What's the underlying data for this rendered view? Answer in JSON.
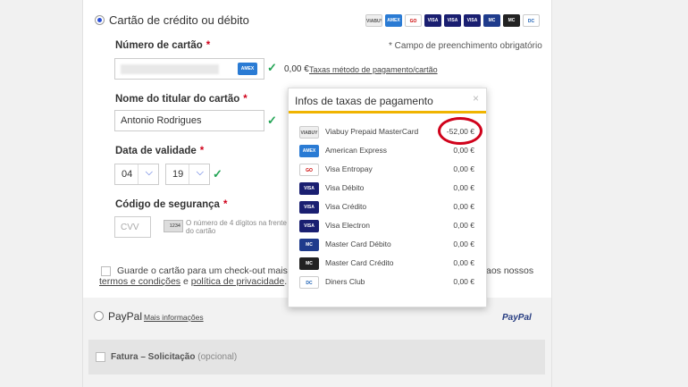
{
  "card_section": {
    "title": "Cartão de crédito ou débito",
    "card_number_label": "Número de cartão",
    "required_note": "* Campo de preenchimento obrigatório",
    "fee_amount": "0,00 €",
    "fee_link": "Taxas método de pagamento/cartão",
    "holder_label": "Nome do titular do cartão",
    "holder_value": "Antonio Rodrigues",
    "expiry_label": "Data de validade",
    "expiry_month": "04",
    "expiry_year": "19",
    "cvv_label": "Código de segurança",
    "cvv_placeholder": "CVV",
    "cvv_card_number": "1234",
    "cvv_help": "O número de 4 dígitos na frente do cartão",
    "save_text": "Guarde o cartão para um check-out mais rápido",
    "save_text_tail": "aos nossos",
    "terms_link": "termos e condições",
    "and_text": "e",
    "privacy_link": "política de privacidade",
    "period": ".",
    "required_mark": "*",
    "check_mark": "✓"
  },
  "header_logos": [
    {
      "name": "viabuy-logo",
      "text": "VIABUY"
    },
    {
      "name": "amex-logo",
      "text": "AMEX"
    },
    {
      "name": "entropay-logo",
      "text": "GO"
    },
    {
      "name": "visa-debit-logo",
      "text": "VISA"
    },
    {
      "name": "visa-logo",
      "text": "VISA"
    },
    {
      "name": "visa-electron-logo",
      "text": "VISA"
    },
    {
      "name": "maestro-logo",
      "text": "MC"
    },
    {
      "name": "mastercard-logo",
      "text": "MC"
    },
    {
      "name": "diners-logo",
      "text": "DC"
    }
  ],
  "popup": {
    "title": "Infos de taxas de pagamento",
    "close": "×",
    "rows": [
      {
        "name": "Viabuy Prepaid MasterCard",
        "amount": "-52,00 €",
        "logo": "VIABUY"
      },
      {
        "name": "American Express",
        "amount": "0,00 €",
        "logo": "AMEX"
      },
      {
        "name": "Visa Entropay",
        "amount": "0,00 €",
        "logo": "GO"
      },
      {
        "name": "Visa Débito",
        "amount": "0,00 €",
        "logo": "VISA"
      },
      {
        "name": "Visa Crédito",
        "amount": "0,00 €",
        "logo": "VISA"
      },
      {
        "name": "Visa Electron",
        "amount": "0,00 €",
        "logo": "VISA"
      },
      {
        "name": "Master Card Débito",
        "amount": "0,00 €",
        "logo": "MC"
      },
      {
        "name": "Master Card Crédito",
        "amount": "0,00 €",
        "logo": "MC"
      },
      {
        "name": "Diners Club",
        "amount": "0,00 €",
        "logo": "DC"
      }
    ]
  },
  "paypal": {
    "label": "PayPal",
    "more_info": "Mais informações",
    "logo_text": "PayPal"
  },
  "invoice": {
    "label": "Fatura – Solicitação",
    "optional": "(opcional)"
  },
  "colors": {
    "accent_blue": "#2a4fd6",
    "required_red": "#d0021b",
    "check_green": "#23a455",
    "popup_bar": "#f0b400"
  }
}
